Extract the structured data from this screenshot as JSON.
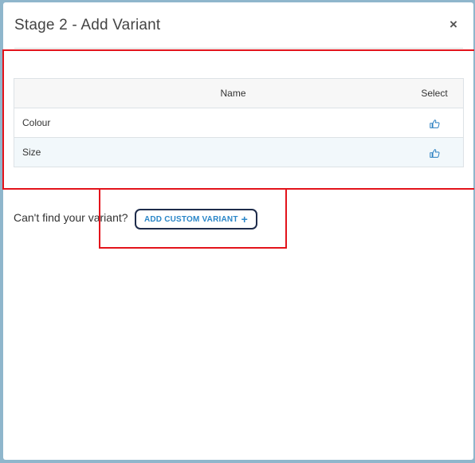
{
  "modal": {
    "title": "Stage 2 - Add Variant",
    "close_symbol": "×"
  },
  "table": {
    "headers": {
      "name": "Name",
      "select": "Select"
    },
    "rows": [
      {
        "name": "Colour",
        "select_icon": "hand-pointer-icon"
      },
      {
        "name": "Size",
        "select_icon": "hand-pointer-icon"
      }
    ]
  },
  "footer": {
    "prompt": "Can't find your variant?",
    "add_button_label": "ADD CUSTOM VARIANT",
    "add_button_icon": "+"
  },
  "colors": {
    "accent": "#2a86c8",
    "highlight": "#e3131b",
    "backdrop": "#8fb6cc"
  }
}
